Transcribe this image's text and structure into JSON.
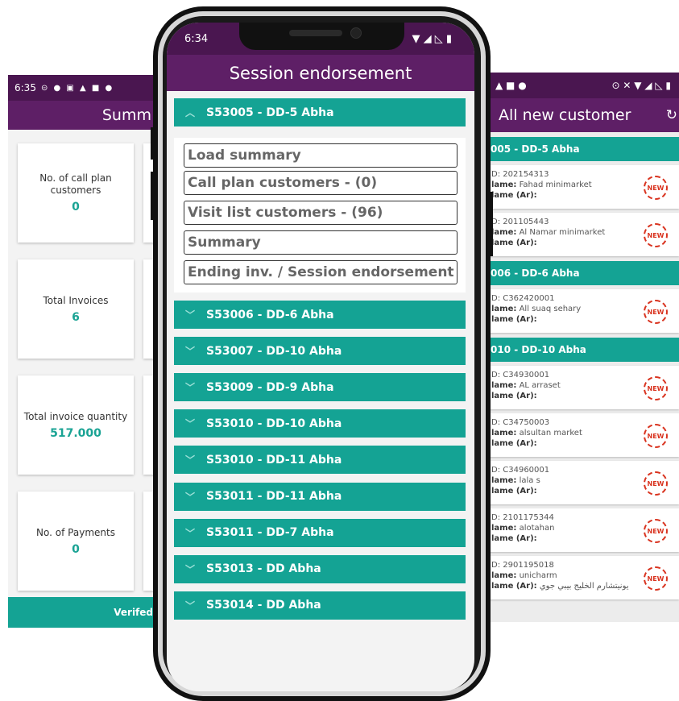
{
  "left_screen": {
    "status_time": "6:35",
    "status_icons": "⊝ ● ▣ ▲ ■ ●",
    "title": "Summ",
    "cards": [
      {
        "label": "No. of call plan customers",
        "value": "0"
      },
      {
        "label": "Total Invoices",
        "value": "6"
      },
      {
        "label": "Total invoice quantity",
        "value": "517.000"
      },
      {
        "label": "No. of Payments",
        "value": "0"
      }
    ],
    "footer_label": "Verifed"
  },
  "middle_screen": {
    "status_time": "6:34",
    "status_icons_right": "▼ ◢ ◺ ▮",
    "title": "Session endorsement",
    "expanded_section": "S53005 - DD-5 Abha",
    "options": [
      "Load summary",
      "Call plan customers - (0)",
      "Visit list customers - (96)",
      "Summary",
      "Ending inv. / Session endorsement"
    ],
    "collapsed_sections": [
      "S53006 - DD-6 Abha",
      "S53007 - DD-10 Abha",
      "S53009 - DD-9 Abha",
      "S53010 - DD-10 Abha",
      "S53010 - DD-11 Abha",
      "S53011 - DD-11 Abha",
      "S53011 - DD-7 Abha",
      "S53013 - DD Abha",
      "S53014 - DD Abha"
    ]
  },
  "right_screen": {
    "status_icons_left": "▲ ■ ●",
    "status_icons_right": "⊙ ✕ ▼ ◢ ◺ ▮",
    "title": "All new customer",
    "refresh_icon": "↻",
    "new_badge": "NEW",
    "groups": [
      {
        "header": "005 - DD-5 Abha",
        "customers": [
          {
            "id": "D: 202154313",
            "name_label": "lame:",
            "name": "Fahad minimarket",
            "ar_label": "lame (Ar):",
            "ar": ""
          },
          {
            "id": "D: 201105443",
            "name_label": "lame:",
            "name": "Al Namar minimarket",
            "ar_label": "lame (Ar):",
            "ar": ""
          }
        ]
      },
      {
        "header": "006 - DD-6 Abha",
        "customers": [
          {
            "id": "D: C362420001",
            "name_label": "lame:",
            "name": "All suaq sehary",
            "ar_label": "lame (Ar):",
            "ar": ""
          }
        ]
      },
      {
        "header": "010 - DD-10 Abha",
        "customers": [
          {
            "id": "D: C34930001",
            "name_label": "lame:",
            "name": "AL arraset",
            "ar_label": "lame (Ar):",
            "ar": ""
          },
          {
            "id": "D: C34750003",
            "name_label": "lame:",
            "name": "alsultan market",
            "ar_label": "lame (Ar):",
            "ar": ""
          },
          {
            "id": "D: C34960001",
            "name_label": "lame:",
            "name": "lala s",
            "ar_label": "lame (Ar):",
            "ar": ""
          },
          {
            "id": "D: 2101175344",
            "name_label": "lame:",
            "name": "alotahan",
            "ar_label": "lame (Ar):",
            "ar": ""
          },
          {
            "id": "D: 2901195018",
            "name_label": "lame:",
            "name": "unicharm",
            "ar_label": "lame (Ar):",
            "ar": "يونيتشارم الخليج بيبي جوي"
          }
        ]
      }
    ]
  },
  "colors": {
    "app_bar": "#5e1f66",
    "status_bar": "#4a1650",
    "accent_teal": "#14a394",
    "new_badge": "#d9331f"
  }
}
